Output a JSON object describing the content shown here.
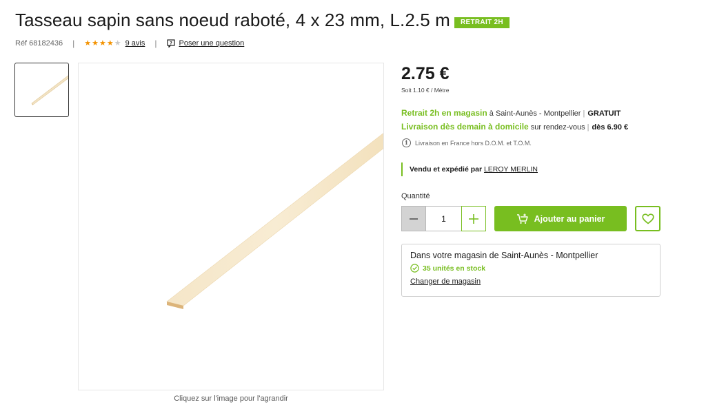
{
  "product": {
    "title": "Tasseau sapin sans noeud raboté, 4 x 23 mm, L.2.5 m",
    "badge": "RETRAIT 2H",
    "ref": "Réf 68182436",
    "rating": 4,
    "rating_max": 5,
    "reviews_label": "9 avis",
    "question_label": "Poser une question"
  },
  "gallery": {
    "caption": "Cliquez sur l'image pour l'agrandir"
  },
  "pricing": {
    "price": "2.75 €",
    "unit_price": "Soit 1.10 € / Mètre"
  },
  "delivery": {
    "pickup_label": "Retrait 2h en magasin",
    "pickup_location": " à Saint-Aunès - Montpellier",
    "pickup_price": "GRATUIT",
    "home_label": "Livraison dès demain à domicile",
    "home_detail": " sur rendez-vous",
    "home_price": "dès 6.90 €",
    "info": "Livraison en France hors D.O.M. et T.O.M."
  },
  "seller": {
    "label": "Vendu et expédié par",
    "name": "LEROY MERLIN"
  },
  "quantity": {
    "label": "Quantité",
    "value": "1"
  },
  "actions": {
    "add_to_cart": "Ajouter au panier"
  },
  "store": {
    "title": "Dans votre magasin de Saint-Aunès - Montpellier",
    "stock": "35 unités en stock",
    "change_label": "Changer de magasin"
  },
  "colors": {
    "accent": "#78be20",
    "star": "#f39200",
    "text": "#1a1a1a"
  },
  "icons": {
    "question": "question-bubble-icon",
    "info": "info-icon",
    "minus": "minus-icon",
    "plus": "plus-icon",
    "cart": "cart-add-icon",
    "favorite": "heart-icon",
    "stock": "check-circle-icon"
  }
}
